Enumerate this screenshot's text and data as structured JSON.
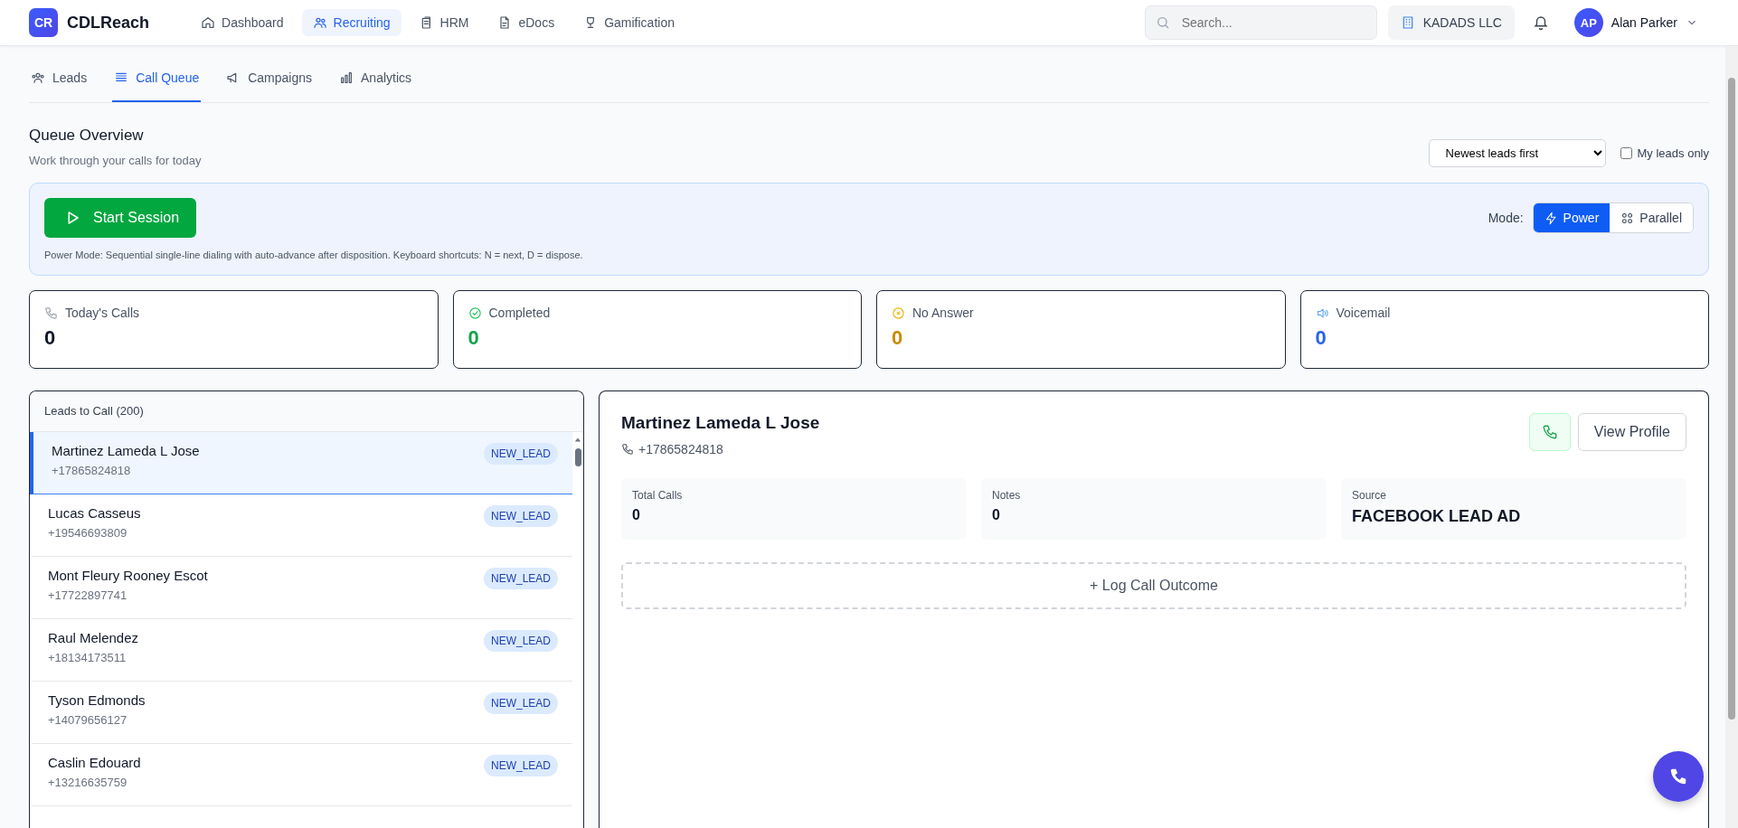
{
  "app": {
    "logo": "CR",
    "brand": "CDLReach"
  },
  "nav": [
    {
      "label": "Dashboard",
      "selected": false
    },
    {
      "label": "Recruiting",
      "selected": true
    },
    {
      "label": "HRM",
      "selected": false
    },
    {
      "label": "eDocs",
      "selected": false
    },
    {
      "label": "Gamification",
      "selected": false
    }
  ],
  "search": {
    "placeholder": "Search..."
  },
  "company": "KADADS LLC",
  "user": {
    "initials": "AP",
    "name": "Alan Parker"
  },
  "subtabs": [
    {
      "label": "Leads",
      "selected": false
    },
    {
      "label": "Call Queue",
      "selected": true
    },
    {
      "label": "Campaigns",
      "selected": false
    },
    {
      "label": "Analytics",
      "selected": false
    }
  ],
  "overview": {
    "title": "Queue Overview",
    "subtitle": "Work through your calls for today",
    "sort": "Newest leads first",
    "my_leads": {
      "label": "My leads only",
      "checked": false
    }
  },
  "session": {
    "button": "Start Session",
    "description": "Power Mode: Sequential single-line dialing with auto-advance after disposition. Keyboard shortcuts: N = next, D = dispose.",
    "mode_label": "Mode:",
    "modes": [
      {
        "label": "Power",
        "selected": true
      },
      {
        "label": "Parallel",
        "selected": false
      }
    ]
  },
  "stats": [
    {
      "label": "Today's Calls",
      "value": "0",
      "color": "#111827"
    },
    {
      "label": "Completed",
      "value": "0",
      "color": "#16a34a"
    },
    {
      "label": "No Answer",
      "value": "0",
      "color": "#ca8a04"
    },
    {
      "label": "Voicemail",
      "value": "0",
      "color": "#2563eb"
    }
  ],
  "leads": {
    "title": "Leads to Call (200)",
    "items": [
      {
        "name": "Martinez Lameda L Jose",
        "phone": "+17865824818",
        "status": "NEW_LEAD",
        "selected": true
      },
      {
        "name": "Lucas Casseus",
        "phone": "+19546693809",
        "status": "NEW_LEAD",
        "selected": false
      },
      {
        "name": "Mont Fleury Rooney Escot",
        "phone": "+17722897741",
        "status": "NEW_LEAD",
        "selected": false
      },
      {
        "name": "Raul Melendez",
        "phone": "+18134173511",
        "status": "NEW_LEAD",
        "selected": false
      },
      {
        "name": "Tyson Edmonds",
        "phone": "+14079656127",
        "status": "NEW_LEAD",
        "selected": false
      },
      {
        "name": "Caslin Edouard",
        "phone": "+13216635759",
        "status": "NEW_LEAD",
        "selected": false
      }
    ]
  },
  "detail": {
    "name": "Martinez Lameda L Jose",
    "phone": "+17865824818",
    "view_profile": "View Profile",
    "metrics": [
      {
        "label": "Total Calls",
        "value": "0"
      },
      {
        "label": "Notes",
        "value": "0"
      },
      {
        "label": "Source",
        "value": "FACEBOOK LEAD AD"
      }
    ],
    "log_button": "+ Log Call Outcome"
  }
}
